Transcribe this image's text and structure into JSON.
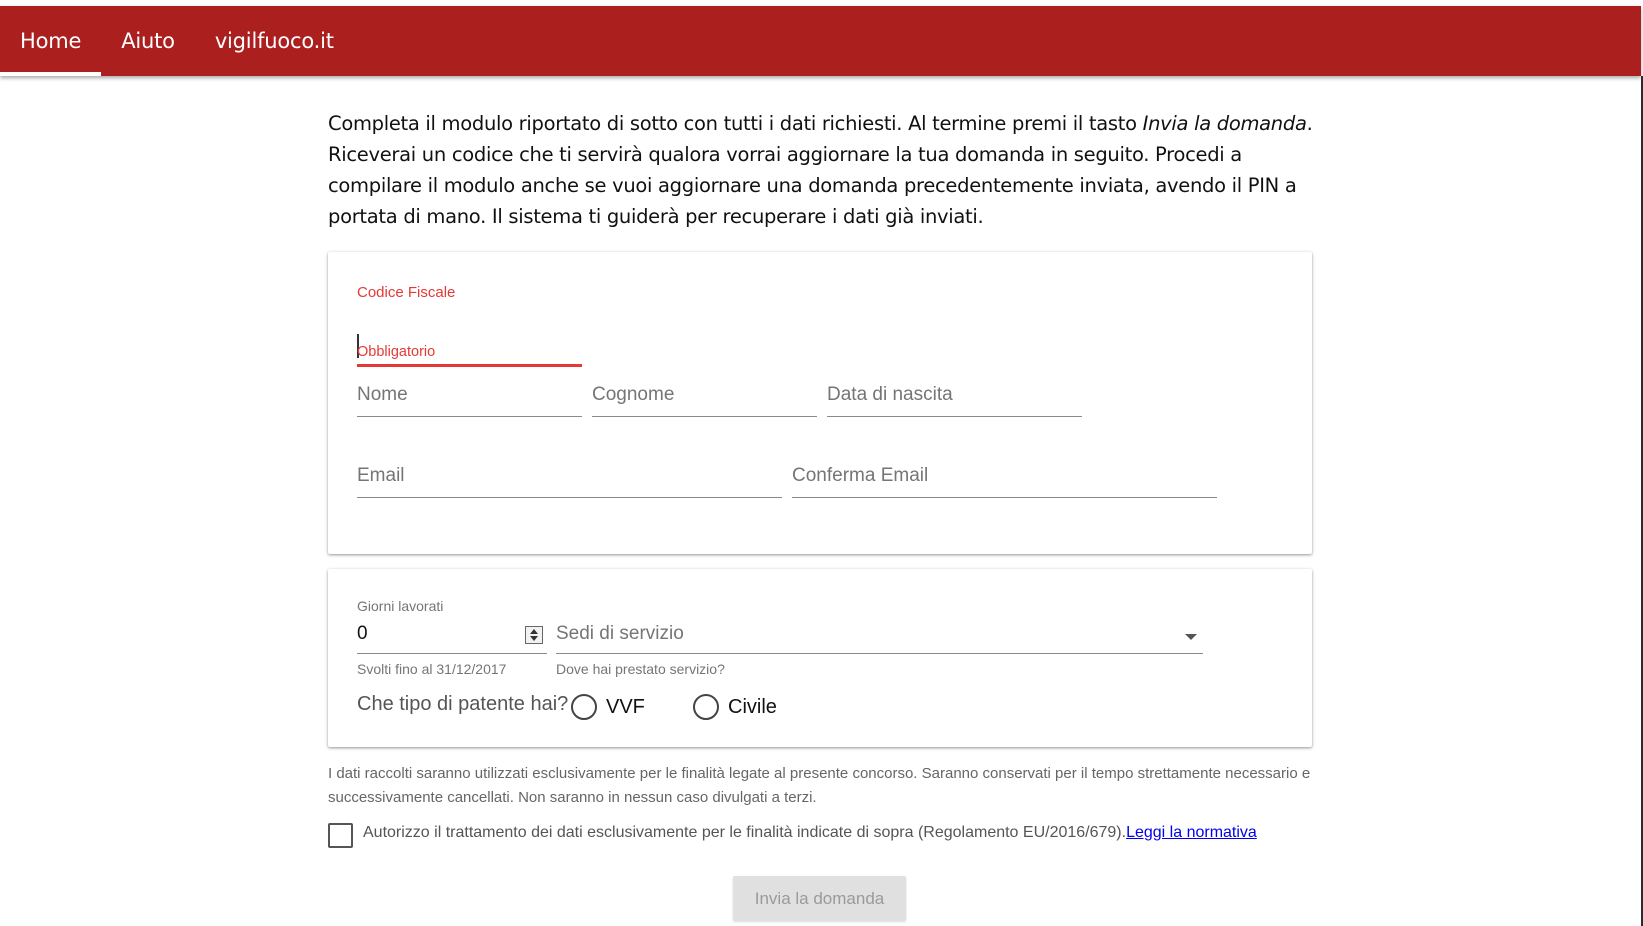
{
  "nav": {
    "items": [
      {
        "label": "Home",
        "active": true
      },
      {
        "label": "Aiuto",
        "active": false
      },
      {
        "label": "vigilfuoco.it",
        "active": false
      }
    ]
  },
  "intro": {
    "before_em": "Completa il modulo riportato di sotto con tutti i dati richiesti. Al termine premi il tasto ",
    "em": "Invia la domanda",
    "after_em": ". Riceverai un codice che ti servirà qualora vorrai aggiornare la tua domanda in seguito. Procedi a compilare il modulo anche se vuoi aggiornare una domanda precedentemente inviata, avendo il PIN a portata di mano. Il sistema ti guiderà per recuperare i dati già inviati."
  },
  "form": {
    "codice_fiscale": {
      "label": "Codice Fiscale",
      "value": "",
      "error": "Obbligatorio"
    },
    "nome": {
      "placeholder": "Nome"
    },
    "cognome": {
      "placeholder": "Cognome"
    },
    "data_nascita": {
      "placeholder": "Data di nascita"
    },
    "email": {
      "placeholder": "Email"
    },
    "conferma_email": {
      "placeholder": "Conferma Email"
    },
    "giorni_lavorati": {
      "label": "Giorni lavorati",
      "value": "0",
      "helper": "Svolti fino al 31/12/2017"
    },
    "sedi_servizio": {
      "placeholder": "Sedi di servizio",
      "helper": "Dove hai prestato servizio?"
    },
    "patente": {
      "question": "Che tipo di patente hai?",
      "options": [
        "VVF",
        "Civile"
      ]
    }
  },
  "privacy": {
    "text": "I dati raccolti saranno utilizzati esclusivamente per le finalità legate al presente concorso. Saranno conservati per il tempo strettamente necessario e successivamente cancellati. Non saranno in nessun caso divulgati a terzi.",
    "consent": "Autorizzo il trattamento dei dati esclusivamente per le finalità indicate di sopra (Regolamento EU/2016/679).",
    "link": "Leggi la normativa"
  },
  "submit_label": "Invia la domanda",
  "colors": {
    "brand": "#ab1f1f",
    "error": "#e53935"
  }
}
